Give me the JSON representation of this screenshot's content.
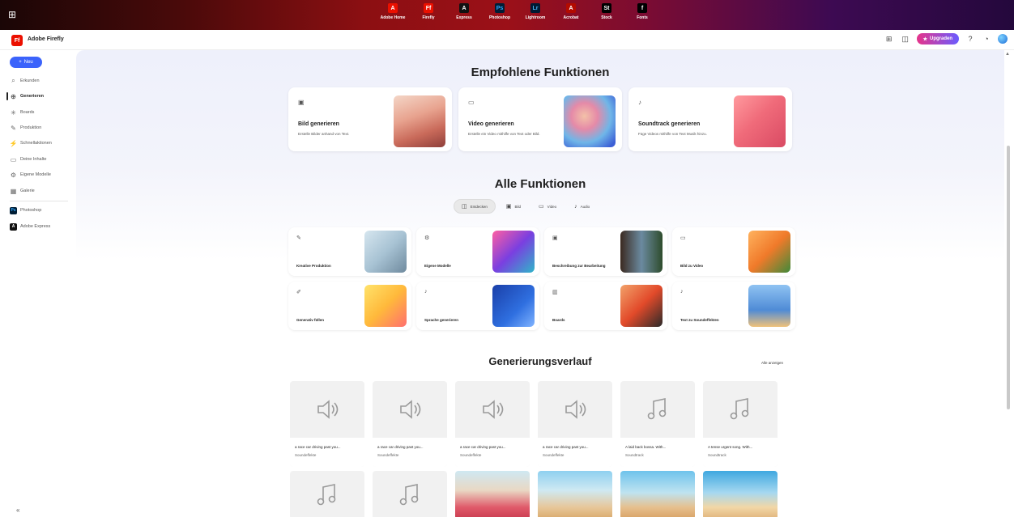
{
  "topbar": {
    "apps": [
      {
        "label": "Adobe Home",
        "glyph": "A",
        "color": "#eb1000"
      },
      {
        "label": "Firefly",
        "glyph": "Ff",
        "color": "#eb1000"
      },
      {
        "label": "Express",
        "glyph": "A",
        "color": "#111111"
      },
      {
        "label": "Photoshop",
        "glyph": "Ps",
        "color": "#001e36"
      },
      {
        "label": "Lightroom",
        "glyph": "Lr",
        "color": "#001a33"
      },
      {
        "label": "Acrobat",
        "glyph": "A",
        "color": "#b30b00"
      },
      {
        "label": "Stock",
        "glyph": "St",
        "color": "#000000"
      },
      {
        "label": "Fonts",
        "glyph": "f",
        "color": "#000000"
      }
    ]
  },
  "header": {
    "brand": "Adobe Firefly",
    "logo": "Ff",
    "upgrade_label": "Upgraden"
  },
  "sidebar": {
    "new_label": "Neu",
    "items": [
      {
        "label": "Erkunden",
        "icon": "⌕"
      },
      {
        "label": "Generieren",
        "icon": "⊕"
      },
      {
        "label": "Boards",
        "icon": "✳"
      },
      {
        "label": "Produktion",
        "icon": "✎"
      },
      {
        "label": "Schnellaktionen",
        "icon": "⚡"
      },
      {
        "label": "Deine Inhalte",
        "icon": "▭"
      },
      {
        "label": "Eigene Modelle",
        "icon": "⚙"
      },
      {
        "label": "Galerie",
        "icon": "▦"
      }
    ],
    "apps": [
      {
        "label": "Photoshop",
        "glyph": "Ps",
        "color": "#001e36"
      },
      {
        "label": "Adobe Express",
        "glyph": "A",
        "color": "#111111"
      }
    ]
  },
  "featured": {
    "title": "Empfohlene Funktionen",
    "cards": [
      {
        "title": "Bild generieren",
        "desc": "Erstelle Bilder anhand von Text.",
        "icon": "▣"
      },
      {
        "title": "Video generieren",
        "desc": "Erstelle ein Video mithilfe von Text oder Bild.",
        "icon": "▭"
      },
      {
        "title": "Soundtrack generieren",
        "desc": "Füge Videos mithilfe von Text Musik hinzu.",
        "icon": "♪"
      }
    ]
  },
  "all": {
    "title": "Alle Funktionen",
    "tabs": [
      {
        "label": "Entdecken",
        "icon": "◫"
      },
      {
        "label": "Bild",
        "icon": "▣"
      },
      {
        "label": "Video",
        "icon": "▭"
      },
      {
        "label": "Audio",
        "icon": "♪"
      }
    ],
    "cards": [
      {
        "title": "Kreative Produktion",
        "icon": "✎"
      },
      {
        "title": "Eigene Modelle",
        "icon": "⚙"
      },
      {
        "title": "Beschreibung zur Bearbeitung",
        "icon": "▣"
      },
      {
        "title": "Bild zu Video",
        "icon": "▭"
      },
      {
        "title": "Generativ füllen",
        "icon": "✐"
      },
      {
        "title": "Sprache generieren",
        "icon": "♪"
      },
      {
        "title": "Boards",
        "icon": "▥"
      },
      {
        "title": "Text zu Soundeffekten",
        "icon": "♪"
      }
    ]
  },
  "history": {
    "title": "Generierungsverlauf",
    "see_all": "Alle anzeigen",
    "items": [
      {
        "title": "a race car driving past you...",
        "sub": "Soundeffekte",
        "icon": "speaker"
      },
      {
        "title": "a race car driving past you...",
        "sub": "Soundeffekte",
        "icon": "speaker"
      },
      {
        "title": "a race car driving past you...",
        "sub": "Soundeffekte",
        "icon": "speaker"
      },
      {
        "title": "a race car driving past you...",
        "sub": "Soundeffekte",
        "icon": "speaker"
      },
      {
        "title": "A laid back bossa. With...",
        "sub": "Soundtrack",
        "icon": "music"
      },
      {
        "title": "A tense urgent song. With...",
        "sub": "Soundtrack",
        "icon": "music"
      }
    ]
  }
}
